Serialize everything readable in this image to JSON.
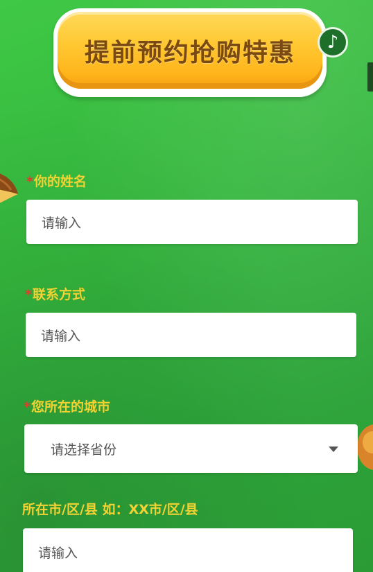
{
  "cta": {
    "label": "提前预约抢购特惠"
  },
  "music": {
    "icon": "music-note-icon",
    "glyph": "♪"
  },
  "form": {
    "required_mark": "*",
    "name": {
      "label": "你的姓名",
      "placeholder": "请输入"
    },
    "contact": {
      "label": "联系方式",
      "placeholder": "请输入"
    },
    "city": {
      "label": "您所在的城市",
      "selected": "请选择省份"
    },
    "district": {
      "label": "所在市/区/县 如：XX市/区/县",
      "placeholder": "请输入"
    }
  },
  "colors": {
    "background": "#35b83e",
    "label": "#f3d234",
    "required": "#e23b2f",
    "cta": "#ffc934",
    "cta_text": "#7a4a12"
  }
}
